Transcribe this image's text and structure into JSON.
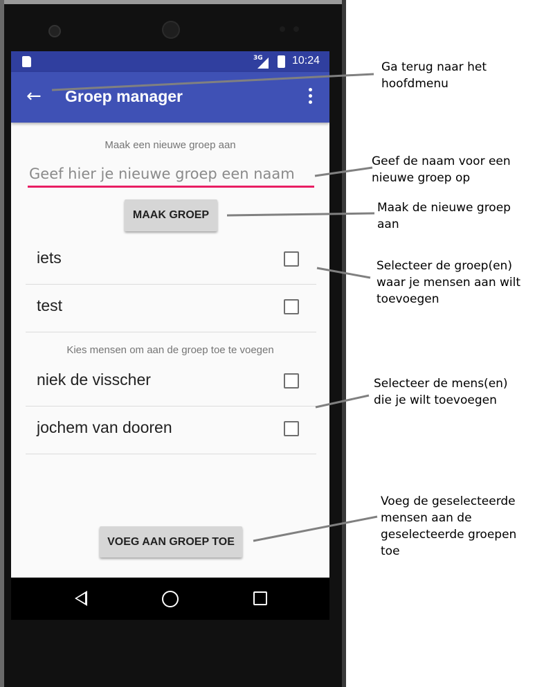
{
  "status_bar": {
    "network": "3G",
    "time": "10:24"
  },
  "app_bar": {
    "back_icon": "arrow-back-icon",
    "title": "Groep manager",
    "menu_icon": "more-vert-icon"
  },
  "new_group": {
    "caption": "Maak een nieuwe groep aan",
    "placeholder": "Geef hier je nieuwe groep een naam",
    "value": "",
    "button_label": "MAAK GROEP"
  },
  "groups": [
    {
      "label": "iets",
      "checked": false
    },
    {
      "label": "test",
      "checked": false
    }
  ],
  "people_caption": "Kies mensen om aan de groep toe te voegen",
  "people": [
    {
      "label": "niek de visscher",
      "checked": false
    },
    {
      "label": "jochem van dooren",
      "checked": false
    }
  ],
  "add_button_label": "VOEG AAN GROEP TOE",
  "nav_bar": {
    "back_icon": "nav-back-icon",
    "home_icon": "nav-home-icon",
    "recents_icon": "nav-recents-icon"
  },
  "annotations": [
    "Ga terug naar het hoofdmenu",
    "Geef de naam voor een nieuwe groep op",
    "Maak de nieuwe groep aan",
    "Selecteer de groep(en) waar je mensen aan wilt toevoegen",
    "Selecteer de mens(en) die je wilt toevoegen",
    "Voeg de geselecteerde mensen aan de geselecteerde groepen toe"
  ],
  "colors": {
    "primary": "#3f51b5",
    "primary_dark": "#303f9f",
    "accent": "#e91e63",
    "screen_bg": "#fafafa",
    "button_bg": "#d6d6d6"
  }
}
